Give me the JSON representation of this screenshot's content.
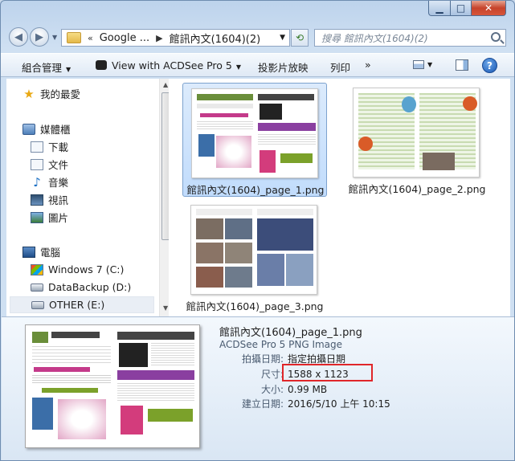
{
  "window": {
    "controls": {
      "minimize": "▁",
      "maximize": "□",
      "close": "✕"
    }
  },
  "nav": {
    "back": "◀",
    "forward": "▶",
    "address_prefix": "«",
    "breadcrumb": [
      "Google ...",
      "館訊內文(1604)(2)"
    ],
    "search_placeholder": "搜尋 館訊內文(1604)(2)"
  },
  "toolbar": {
    "organize": "組合管理",
    "acdsee": "View with ACDSee Pro 5",
    "slideshow": "投影片放映",
    "print": "列印",
    "more": "»"
  },
  "sidebar": {
    "favorites": "我的最愛",
    "libraries": "媒體櫃",
    "library_items": [
      "下載",
      "文件",
      "音樂",
      "視訊",
      "圖片"
    ],
    "computer": "電腦",
    "drives": [
      "Windows 7 (C:)",
      "DataBackup (D:)",
      "OTHER (E:)"
    ]
  },
  "files": [
    {
      "name": "館訊內文(1604)_page_1.png",
      "selected": true
    },
    {
      "name": "館訊內文(1604)_page_2.png",
      "selected": false
    },
    {
      "name": "館訊內文(1604)_page_3.png",
      "selected": false
    }
  ],
  "details": {
    "filename": "館訊內文(1604)_page_1.png",
    "filetype": "ACDSee Pro 5 PNG Image",
    "properties": [
      {
        "key": "拍攝日期:",
        "value": "指定拍攝日期"
      },
      {
        "key": "尺寸:",
        "value": "1588 x 1123"
      },
      {
        "key": "大小:",
        "value": "0.99 MB"
      },
      {
        "key": "建立日期:",
        "value": "2016/5/10 上午 10:15"
      }
    ]
  },
  "colors": {
    "selection": "#c1dcfc",
    "highlight_box": "#e0262a",
    "title_bar": "#bdd3ec"
  }
}
